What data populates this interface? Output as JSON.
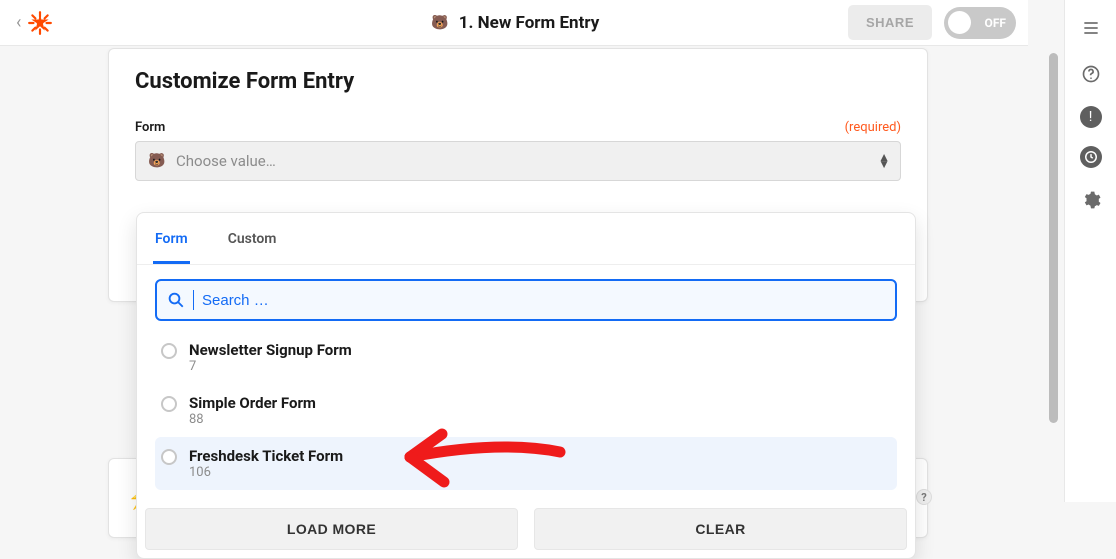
{
  "topbar": {
    "title": "1. New Form Entry",
    "share_label": "SHARE",
    "toggle_label": "OFF"
  },
  "card": {
    "title": "Customize Form Entry",
    "field_label": "Form",
    "required_label": "(required)",
    "placeholder": "Choose value…"
  },
  "dropdown": {
    "tabs": {
      "form": "Form",
      "custom": "Custom"
    },
    "search_placeholder": "Search …",
    "options": [
      {
        "title": "Newsletter Signup Form",
        "sub": "7"
      },
      {
        "title": "Simple Order Form",
        "sub": "88"
      },
      {
        "title": "Freshdesk Ticket Form",
        "sub": "106"
      }
    ],
    "load_more_label": "LOAD MORE",
    "clear_label": "CLEAR"
  }
}
